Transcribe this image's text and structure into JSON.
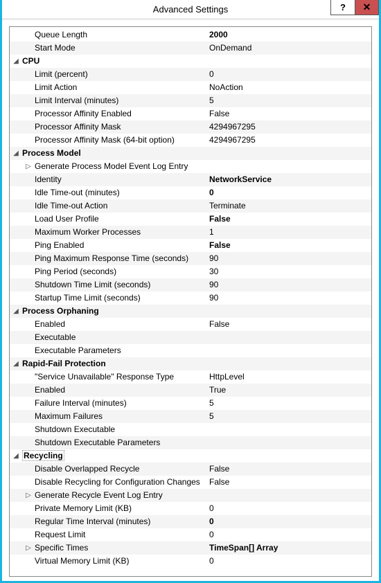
{
  "window": {
    "title": "Advanced Settings",
    "help": "?",
    "close": "✕"
  },
  "glyph": {
    "expanded": "◢",
    "collapsed": "▷"
  },
  "rows": [
    {
      "type": "prop",
      "alt": 0,
      "label": "Queue Length",
      "value": "2000",
      "bold": true
    },
    {
      "type": "prop",
      "alt": 1,
      "label": "Start Mode",
      "value": "OnDemand"
    },
    {
      "type": "cat",
      "alt": 0,
      "label": "CPU",
      "state": "expanded"
    },
    {
      "type": "prop",
      "alt": 1,
      "label": "Limit (percent)",
      "value": "0"
    },
    {
      "type": "prop",
      "alt": 0,
      "label": "Limit Action",
      "value": "NoAction"
    },
    {
      "type": "prop",
      "alt": 1,
      "label": "Limit Interval (minutes)",
      "value": "5"
    },
    {
      "type": "prop",
      "alt": 0,
      "label": "Processor Affinity Enabled",
      "value": "False"
    },
    {
      "type": "prop",
      "alt": 1,
      "label": "Processor Affinity Mask",
      "value": "4294967295"
    },
    {
      "type": "prop",
      "alt": 0,
      "label": "Processor Affinity Mask (64-bit option)",
      "value": "4294967295"
    },
    {
      "type": "cat",
      "alt": 1,
      "label": "Process Model",
      "state": "expanded"
    },
    {
      "type": "sub",
      "alt": 0,
      "label": "Generate Process Model Event Log Entry",
      "state": "collapsed"
    },
    {
      "type": "prop",
      "alt": 1,
      "label": "Identity",
      "value": "NetworkService",
      "bold": true
    },
    {
      "type": "prop",
      "alt": 0,
      "label": "Idle Time-out (minutes)",
      "value": "0",
      "bold": true
    },
    {
      "type": "prop",
      "alt": 1,
      "label": "Idle Time-out Action",
      "value": "Terminate"
    },
    {
      "type": "prop",
      "alt": 0,
      "label": "Load User Profile",
      "value": "False",
      "bold": true
    },
    {
      "type": "prop",
      "alt": 1,
      "label": "Maximum Worker Processes",
      "value": "1"
    },
    {
      "type": "prop",
      "alt": 0,
      "label": "Ping Enabled",
      "value": "False",
      "bold": true
    },
    {
      "type": "prop",
      "alt": 1,
      "label": "Ping Maximum Response Time (seconds)",
      "value": "90"
    },
    {
      "type": "prop",
      "alt": 0,
      "label": "Ping Period (seconds)",
      "value": "30"
    },
    {
      "type": "prop",
      "alt": 1,
      "label": "Shutdown Time Limit (seconds)",
      "value": "90"
    },
    {
      "type": "prop",
      "alt": 0,
      "label": "Startup Time Limit (seconds)",
      "value": "90"
    },
    {
      "type": "cat",
      "alt": 1,
      "label": "Process Orphaning",
      "state": "expanded"
    },
    {
      "type": "prop",
      "alt": 0,
      "label": "Enabled",
      "value": "False"
    },
    {
      "type": "prop",
      "alt": 1,
      "label": "Executable",
      "value": ""
    },
    {
      "type": "prop",
      "alt": 0,
      "label": "Executable Parameters",
      "value": ""
    },
    {
      "type": "cat",
      "alt": 1,
      "label": "Rapid-Fail Protection",
      "state": "expanded"
    },
    {
      "type": "prop",
      "alt": 0,
      "label": "\"Service Unavailable\" Response Type",
      "value": "HttpLevel"
    },
    {
      "type": "prop",
      "alt": 1,
      "label": "Enabled",
      "value": "True"
    },
    {
      "type": "prop",
      "alt": 0,
      "label": "Failure Interval (minutes)",
      "value": "5"
    },
    {
      "type": "prop",
      "alt": 1,
      "label": "Maximum Failures",
      "value": "5"
    },
    {
      "type": "prop",
      "alt": 0,
      "label": "Shutdown Executable",
      "value": ""
    },
    {
      "type": "prop",
      "alt": 1,
      "label": "Shutdown Executable Parameters",
      "value": ""
    },
    {
      "type": "cat",
      "alt": 0,
      "label": "Recycling",
      "state": "expanded",
      "selected": true
    },
    {
      "type": "prop",
      "alt": 1,
      "label": "Disable Overlapped Recycle",
      "value": "False"
    },
    {
      "type": "prop",
      "alt": 0,
      "label": "Disable Recycling for Configuration Changes",
      "value": "False"
    },
    {
      "type": "sub",
      "alt": 1,
      "label": "Generate Recycle Event Log Entry",
      "state": "collapsed"
    },
    {
      "type": "prop",
      "alt": 0,
      "label": "Private Memory Limit (KB)",
      "value": "0"
    },
    {
      "type": "prop",
      "alt": 1,
      "label": "Regular Time Interval (minutes)",
      "value": "0",
      "bold": true
    },
    {
      "type": "prop",
      "alt": 0,
      "label": "Request Limit",
      "value": "0"
    },
    {
      "type": "sub",
      "alt": 1,
      "label": "Specific Times",
      "state": "collapsed",
      "value": "TimeSpan[] Array",
      "bold": true
    },
    {
      "type": "prop",
      "alt": 0,
      "label": "Virtual Memory Limit (KB)",
      "value": "0"
    }
  ]
}
